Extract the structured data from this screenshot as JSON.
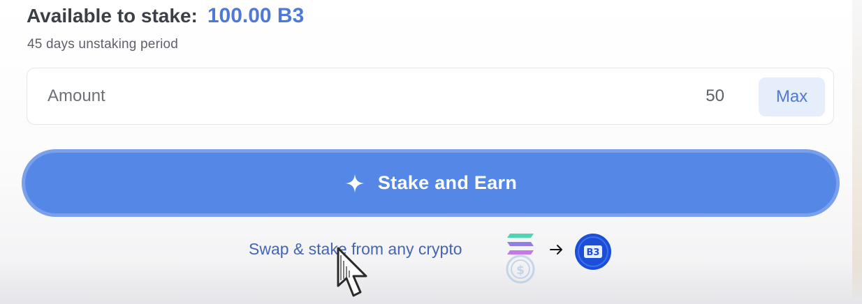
{
  "header": {
    "label": "Available to stake:",
    "value": "100.00 B3"
  },
  "subtext": "45 days unstaking period",
  "amount_field": {
    "label": "Amount",
    "value": "50",
    "max_label": "Max"
  },
  "stake_button": {
    "label": "Stake and Earn",
    "icon": "sparkle-icon"
  },
  "swap": {
    "link_text": "Swap & stake from any crypto",
    "token_icons": [
      "solana-icon",
      "usdc-icon"
    ],
    "arrow_icon": "arrow-right-icon",
    "target_icon": "b3-token-icon",
    "target_label": "B3"
  },
  "colors": {
    "accent": "#4f79d6",
    "button": "#5588e6",
    "link": "#4466b2"
  }
}
